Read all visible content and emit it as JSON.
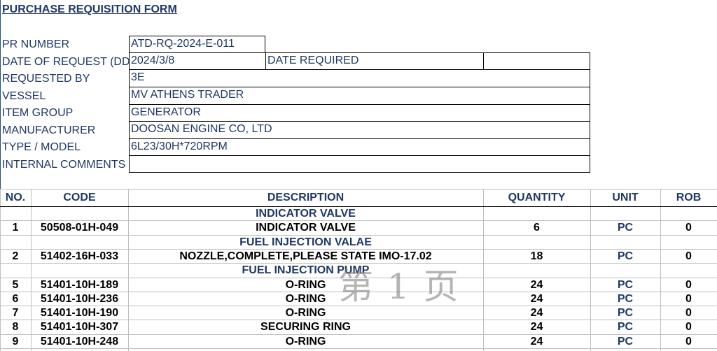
{
  "title": "PURCHASE REQUISITION FORM",
  "fields": {
    "pr_number": {
      "label": "PR NUMBER",
      "value": "ATD-RQ-2024-E-011"
    },
    "date_of_request": {
      "label": "DATE OF REQUEST (DD",
      "value": "2024/3/8"
    },
    "date_required": {
      "label": "DATE REQUIRED",
      "value": ""
    },
    "requested_by": {
      "label": "REQUESTED BY",
      "value": "3E"
    },
    "vessel": {
      "label": "VESSEL",
      "value": "MV ATHENS TRADER"
    },
    "item_group": {
      "label": "ITEM GROUP",
      "value": "GENERATOR"
    },
    "manufacturer": {
      "label": "MANUFACTURER",
      "value": "DOOSAN ENGINE CO, LTD"
    },
    "type_model": {
      "label": "TYPE / MODEL",
      "value": "6L23/30H*720RPM"
    },
    "internal_comments": {
      "label": "INTERNAL COMMENTS",
      "value": ""
    }
  },
  "table": {
    "headers": {
      "no": "NO.",
      "code": "CODE",
      "description": "DESCRIPTION",
      "quantity": "QUANTITY",
      "unit": "UNIT",
      "rob": "ROB"
    },
    "rows": [
      {
        "no": "",
        "code": "",
        "description": "INDICATOR  VALVE",
        "quantity": "",
        "unit": "",
        "rob": "",
        "group": true
      },
      {
        "no": "1",
        "code": "50508-01H-049",
        "description": "INDICATOR  VALVE",
        "quantity": "6",
        "unit": "PC",
        "rob": "0"
      },
      {
        "no": "",
        "code": "",
        "description": "FUEL INJECTION VALAE",
        "quantity": "",
        "unit": "",
        "rob": "",
        "group": true
      },
      {
        "no": "2",
        "code": "51402-16H-033",
        "description": "NOZZLE,COMPLETE,PLEASE STATE IMO-17.02",
        "quantity": "18",
        "unit": "PC",
        "rob": "0"
      },
      {
        "no": "",
        "code": "",
        "description": "FUEL INJECTION PUMP",
        "quantity": "",
        "unit": "",
        "rob": "",
        "group": true
      },
      {
        "no": "5",
        "code": "51401-10H-189",
        "description": "O-RING",
        "quantity": "24",
        "unit": "PC",
        "rob": "0"
      },
      {
        "no": "6",
        "code": "51401-10H-236",
        "description": "O-RING",
        "quantity": "24",
        "unit": "PC",
        "rob": "0"
      },
      {
        "no": "7",
        "code": "51401-10H-190",
        "description": "O-RING",
        "quantity": "24",
        "unit": "PC",
        "rob": "0"
      },
      {
        "no": "8",
        "code": "51401-10H-307",
        "description": "SECURING RING",
        "quantity": "24",
        "unit": "PC",
        "rob": "0"
      },
      {
        "no": "9",
        "code": "51401-10H-248",
        "description": "O-RING",
        "quantity": "24",
        "unit": "PC",
        "rob": "0"
      }
    ]
  },
  "watermark": "第 1 页",
  "colors": {
    "title_text": "#1f3864",
    "group_text": "#1f3864",
    "unit_text": "#1f3864",
    "grid": "#bfbfbf"
  }
}
